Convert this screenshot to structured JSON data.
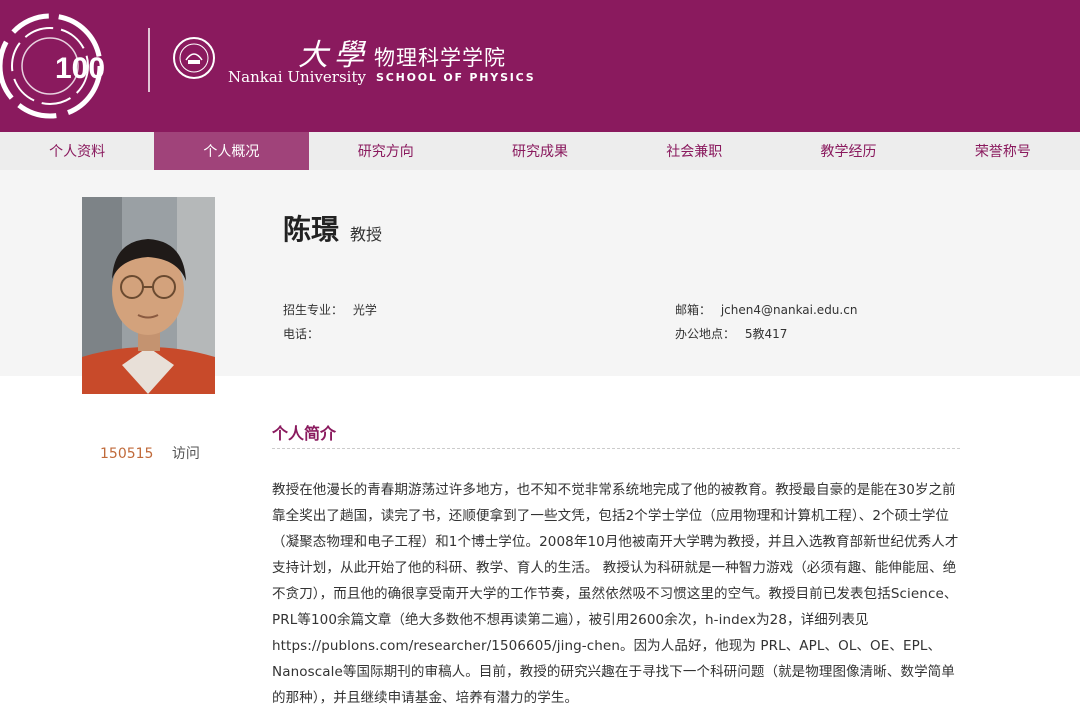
{
  "header": {
    "logo_number": "100",
    "university_cn": "大學",
    "university_en": "Nankai University",
    "school_cn": "物理科学学院",
    "school_en": "SCHOOL OF PHYSICS",
    "brand_color": "#8a1a5e"
  },
  "nav": {
    "items": [
      "个人资料",
      "个人概况",
      "研究方向",
      "研究成果",
      "社会兼职",
      "教学经历",
      "荣誉称号"
    ],
    "active_index": 1
  },
  "profile": {
    "name": "陈璟",
    "title": "教授",
    "major_label": "招生专业：",
    "major_value": "光学",
    "phone_label": "电话：",
    "phone_value": "",
    "email_label": "邮箱：",
    "email_value": "jchen4@nankai.edu.cn",
    "office_label": "办公地点：",
    "office_value": "5教417"
  },
  "visits": {
    "count": "150515",
    "label": "访问"
  },
  "bio": {
    "section_title": "个人简介",
    "text": "教授在他漫长的青春期游荡过许多地方，也不知不觉非常系统地完成了他的被教育。教授最自豪的是能在30岁之前靠全奖出了趟国，读完了书，还顺便拿到了一些文凭，包括2个学士学位（应用物理和计算机工程）、2个硕士学位（凝聚态物理和电子工程）和1个博士学位。2008年10月他被南开大学聘为教授，并且入选教育部新世纪优秀人才支持计划，从此开始了他的科研、教学、育人的生活。 教授认为科研就是一种智力游戏（必须有趣、能伸能屈、绝不贪刀），而且他的确很享受南开大学的工作节奏，虽然依然吸不习惯这里的空气。教授目前已发表包括Science、PRL等100余篇文章（绝大多数他不想再读第二遍），被引用2600余次，h-index为28，详细列表见https://publons.com/researcher/1506605/jing-chen。因为人品好，他现为 PRL、APL、OL、OE、EPL、Nanoscale等国际期刊的审稿人。目前，教授的研究兴趣在于寻找下一个科研问题（就是物理图像清晰、数学简单的那种），并且继续申请基金、培养有潜力的学生。"
  }
}
